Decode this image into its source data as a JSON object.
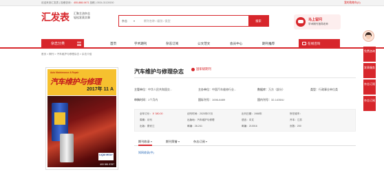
{
  "topbar": {
    "welcome": "欢迎来到汇发表 | 投稿咨询：",
    "phone": "400-888-9471",
    "extra": "投稿 | 0534-31128150",
    "cart": "我的购物车(0)"
  },
  "header": {
    "logo": "汇发表",
    "slogan_line1": "汇聚主流杂志",
    "slogan_line2": "轻松发表文章",
    "search_category": "杂志",
    "search_placeholder": "期刊名称 / 级别 / 类型",
    "search_button": "搜索",
    "consult_title": "马上留问",
    "consult_sub": "学术期刊指导老师"
  },
  "nav": {
    "categories": "杂志分类",
    "items": [
      "首页",
      "学术期刊",
      "杂志订阅",
      "公文范文",
      "会员中心",
      "期刊推荐"
    ],
    "live": "在线咨询"
  },
  "breadcrumb": "首页 > 期刊 > 汽车维护与修理杂志 > 杂志介绍",
  "cover": {
    "en_title": "Auto Maintenance & Repair",
    "cn_title": "汽车维护与修理",
    "issue": "2017年 11 A",
    "brand": "LIQUI MOLY",
    "phone": "400 881 8787"
  },
  "magazine": {
    "title": "汽车维护与修理杂志",
    "badge": "国家级期刊",
    "rows": [
      [
        {
          "label": "主管单位：",
          "value": "中华人民共和国交..."
        },
        {
          "label": "主办单位：",
          "value": "中国汽车维修行业..."
        },
        {
          "label": "数据库：",
          "value": "万方（部分）"
        },
        {
          "label": "类型：",
          "value": "行政事业单位类"
        }
      ],
      [
        {
          "label": "审稿时间：",
          "value": "1个月内"
        },
        {
          "label": "国际刊号：",
          "value": "1006-6489"
        },
        {
          "label": "国内刊号：",
          "value": "32-1435/U"
        }
      ]
    ],
    "spec": {
      "price_label": "全年订价：",
      "price": "￥ 380.00",
      "found_label": "创刊时间：",
      "found": "2020年07月",
      "cycle_label": "出刊日期：",
      "cycle": "1988年",
      "city_label": "所在城市：",
      "city": "",
      "freq_label": "周期：",
      "freq": "月刊",
      "unit_label": "出版地：",
      "unit": "汽车维护与修理",
      "lang_label": "语言：",
      "lang": "中文",
      "open_label": "开本：",
      "open": "江苏",
      "mail_label": "邮发代号：",
      "mail": "",
      "postal_label": "邮编：",
      "postal": "28-241",
      "zip_label": "邮编：",
      "zip": "210016",
      "pages_label": "页数：",
      "pages": "200",
      "place_label": "出版：",
      "place": "泰安江"
    },
    "tabs": [
      "期刊收录",
      "期刊荣誉",
      "杂志订阅"
    ],
    "tab_link": "知网收录(中)"
  },
  "side": [
    "免费咨询",
    "发表服务",
    "杂志订阅",
    "杂志订阅"
  ]
}
